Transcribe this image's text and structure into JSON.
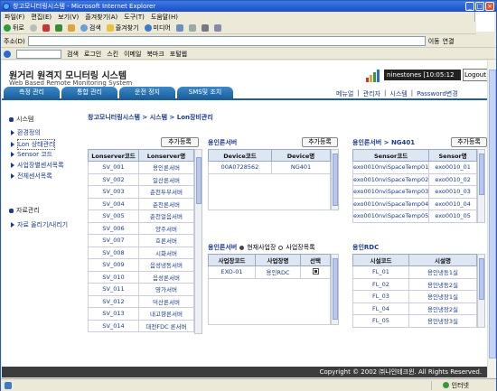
{
  "window": {
    "title": "창고모니터링시스템 - Microsoft Internet Explorer"
  },
  "menu": [
    "파일(F)",
    "편집(E)",
    "보기(V)",
    "즐겨찾기(A)",
    "도구(T)",
    "도움말(H)"
  ],
  "toolbar": {
    "back": "뒤로",
    "search": "검색",
    "favorites": "즐겨찾기",
    "media": "미디어"
  },
  "address": {
    "label": "주소(D)",
    "go": "이동",
    "links": "연결"
  },
  "linksbar": {
    "search": "검색",
    "login": "로그인",
    "scrap": "스킨",
    "email": "이메일",
    "bookmark": "북마크",
    "portal": "포털웹"
  },
  "app": {
    "title": "원거리 원격지 모니터링 시스템",
    "subtitle": "Web Based Remote Monitoring System",
    "user": "ninestones [10:05:12 AM]",
    "logout": "Logout"
  },
  "tabs": [
    "측정 관리",
    "통합 관리",
    "운전 정지",
    "SMS및 조치"
  ],
  "topnav": [
    "메뉴얼",
    "관리자",
    "시스템",
    "Password변경"
  ],
  "sidebar": {
    "system_title": "시스템",
    "items": [
      "환경정의",
      "Lon 상태관리",
      "Sensor 코드",
      "사업장별센서목록",
      "전체센서목록"
    ],
    "data_title": "자료관리",
    "data_items": [
      "자료 올리기/내리기"
    ]
  },
  "breadcrumb": "창고모니터링시스템 > 시스템 > Lon장비관리",
  "lonserver": {
    "add": "추가등록",
    "headers": [
      "Lonserver코드",
      "Lonserver명"
    ],
    "rows": [
      [
        "SV_001",
        "용인론서버"
      ],
      [
        "SV_002",
        "일산론서버"
      ],
      [
        "SV_003",
        "춘천두부서버"
      ],
      [
        "SV_004",
        "춘천론서버"
      ],
      [
        "SV_005",
        "춘천얼음서버"
      ],
      [
        "SV_006",
        "양주서버"
      ],
      [
        "SV_007",
        "호론서버"
      ],
      [
        "SV_008",
        "시화서버"
      ],
      [
        "SV_009",
        "음성냉동서버"
      ],
      [
        "SV_010",
        "음성론서버"
      ],
      [
        "SV_011",
        "영가서버"
      ],
      [
        "SV_012",
        "덕산론서버"
      ],
      [
        "SV_013",
        "내고향론서버"
      ],
      [
        "SV_014",
        "대전FDC 론서버"
      ]
    ]
  },
  "device": {
    "title": "용인론서버",
    "add": "추가등록",
    "headers": [
      "Device코드",
      "Device명"
    ],
    "rows": [
      [
        "00A0728562",
        "NG401"
      ]
    ]
  },
  "sensor": {
    "title": "용인론서버 > NG401",
    "add": "추가등록",
    "headers": [
      "Sensor코드",
      "Sensor명"
    ],
    "rows": [
      [
        "exo0010nviSpaceTemp01",
        "exo0010_01"
      ],
      [
        "exo0010nviSpaceTemp02",
        "exo0010_02"
      ],
      [
        "exo0010nviSpaceTemp03",
        "exo0010_03"
      ],
      [
        "exo0010nviSpaceTemp04",
        "exo0010_04"
      ],
      [
        "exo0010nviSpaceTemp05",
        "exo0010_05"
      ]
    ]
  },
  "site": {
    "title": "용인론서버",
    "radio_current": "현재사업장",
    "radio_all": "사업장목록",
    "headers": [
      "사업장코드",
      "사업장명",
      "선택"
    ],
    "rows": [
      [
        "EXO-01",
        "용인RDC"
      ]
    ]
  },
  "rdc": {
    "title": "용인RDC",
    "headers": [
      "시설코드",
      "시설명"
    ],
    "rows": [
      [
        "FL_01",
        "용인냉동1실"
      ],
      [
        "FL_02",
        "용인냉동2실"
      ],
      [
        "FL_03",
        "용인냉장1실"
      ],
      [
        "FL_04",
        "용인냉장2실"
      ],
      [
        "FL_05",
        "용인냉장3실"
      ]
    ]
  },
  "footer": "Copyright © 2002 ㈜나인테크윈. All Rights Reserved.",
  "status": {
    "zone": "인터넷"
  }
}
